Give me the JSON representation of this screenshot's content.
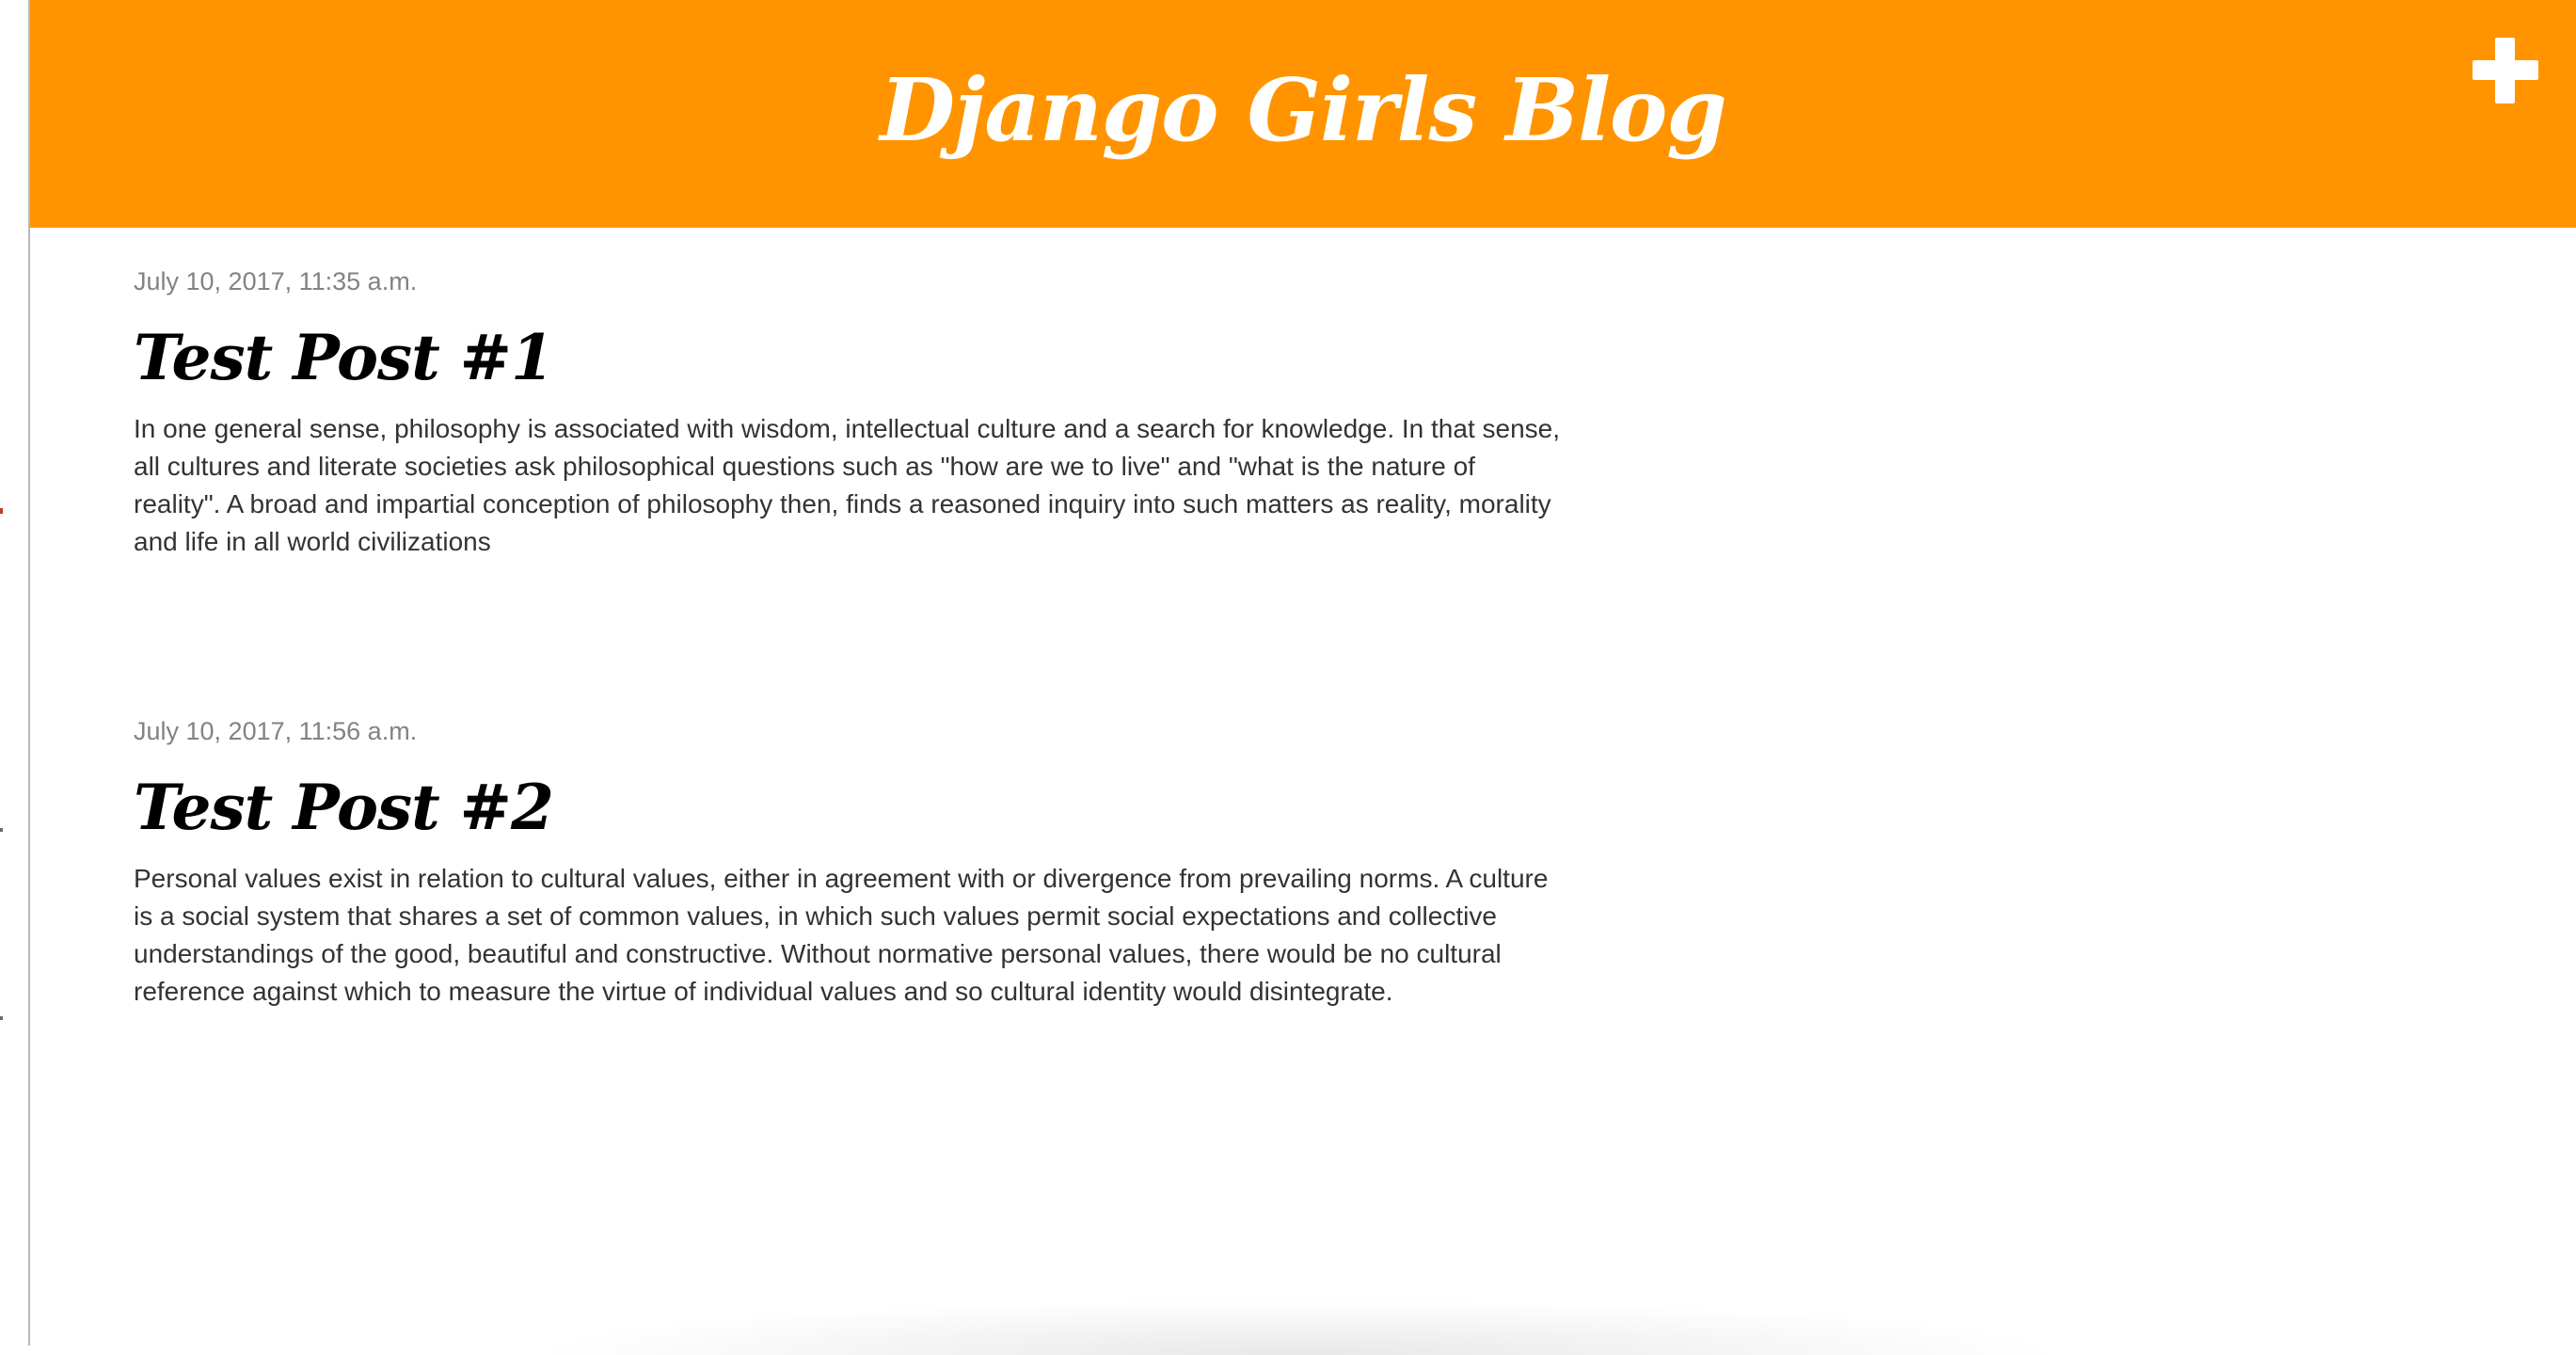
{
  "header": {
    "title": "Django Girls Blog",
    "background_color": "#ff9400",
    "add_icon": "plus-icon"
  },
  "posts": [
    {
      "date": "July 10, 2017, 11:35 a.m.",
      "title": "Test Post #1",
      "body": "In one general sense, philosophy is associated with wisdom, intellectual culture and a search for knowledge. In that sense, all cultures and literate societies ask philosophical questions such as \"how are we to live\" and \"what is the nature of reality\". A broad and impartial conception of philosophy then, finds a reasoned inquiry into such matters as reality, morality and life in all world civilizations"
    },
    {
      "date": "July 10, 2017, 11:56 a.m.",
      "title": "Test Post #2",
      "body": "Personal values exist in relation to cultural values, either in agreement with or divergence from prevailing norms. A culture is a social system that shares a set of common values, in which such values permit social expectations and collective understandings of the good, beautiful and constructive. Without normative personal values, there would be no cultural reference against which to measure the virtue of individual values and so cultural identity would disintegrate."
    }
  ]
}
